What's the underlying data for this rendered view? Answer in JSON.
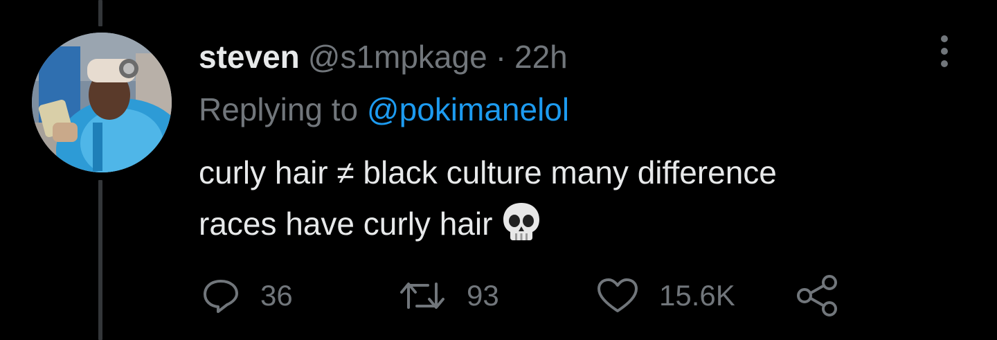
{
  "tweet": {
    "author_name": "steven",
    "author_handle": "@s1mpkage",
    "separator": "·",
    "time": "22h",
    "replying_prefix": "Replying to",
    "replying_to": "@pokimanelol",
    "text_line1": "curly hair ≠ black culture many difference",
    "text_line2": "races have curly hair",
    "emoji": "skull-emoji",
    "counts": {
      "replies": "36",
      "retweets": "93",
      "likes": "15.6K"
    }
  },
  "icons": {
    "reply": "reply-icon",
    "retweet": "retweet-icon",
    "like": "heart-icon",
    "share": "share-icon",
    "more": "more-vertical-icon"
  },
  "colors": {
    "background": "#000000",
    "text_primary": "#e7e9ea",
    "text_secondary": "#71767b",
    "mention": "#1d9bf0",
    "thread_line": "#333639"
  }
}
